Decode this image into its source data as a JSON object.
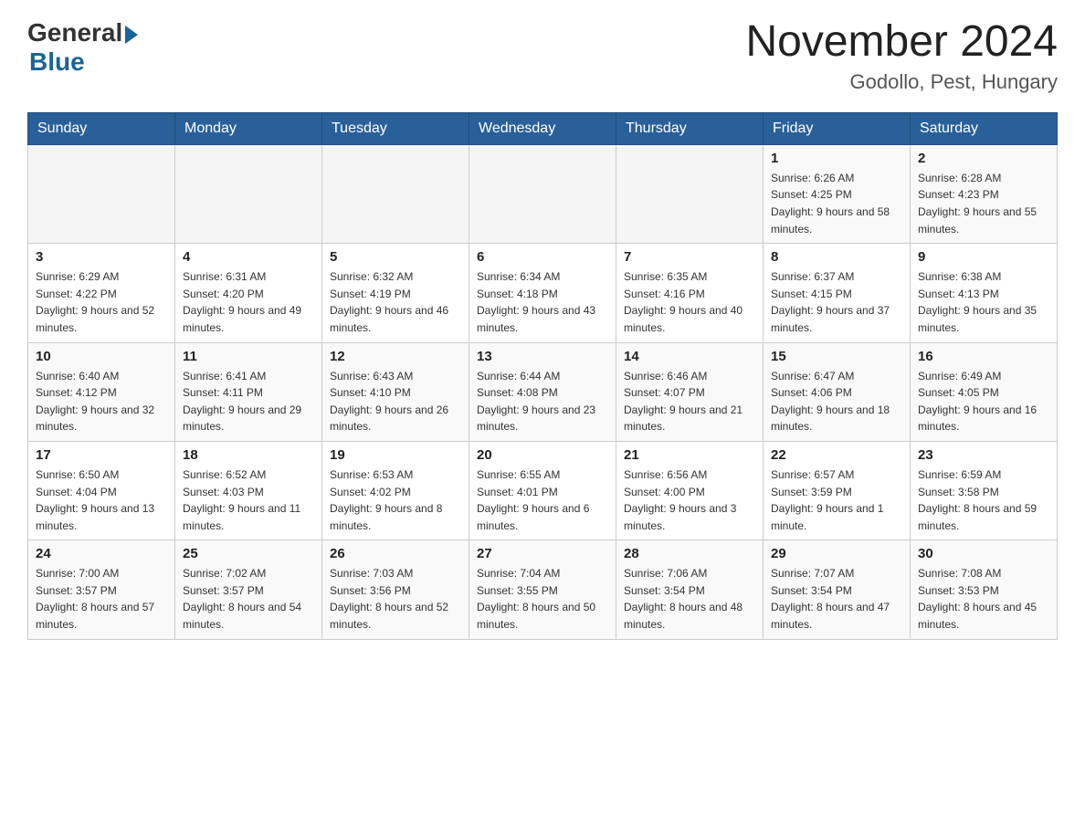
{
  "header": {
    "logo_general": "General",
    "logo_blue": "Blue",
    "month_title": "November 2024",
    "location": "Godollo, Pest, Hungary"
  },
  "days_of_week": [
    "Sunday",
    "Monday",
    "Tuesday",
    "Wednesday",
    "Thursday",
    "Friday",
    "Saturday"
  ],
  "weeks": [
    [
      {
        "day": "",
        "info": ""
      },
      {
        "day": "",
        "info": ""
      },
      {
        "day": "",
        "info": ""
      },
      {
        "day": "",
        "info": ""
      },
      {
        "day": "",
        "info": ""
      },
      {
        "day": "1",
        "info": "Sunrise: 6:26 AM\nSunset: 4:25 PM\nDaylight: 9 hours and 58 minutes."
      },
      {
        "day": "2",
        "info": "Sunrise: 6:28 AM\nSunset: 4:23 PM\nDaylight: 9 hours and 55 minutes."
      }
    ],
    [
      {
        "day": "3",
        "info": "Sunrise: 6:29 AM\nSunset: 4:22 PM\nDaylight: 9 hours and 52 minutes."
      },
      {
        "day": "4",
        "info": "Sunrise: 6:31 AM\nSunset: 4:20 PM\nDaylight: 9 hours and 49 minutes."
      },
      {
        "day": "5",
        "info": "Sunrise: 6:32 AM\nSunset: 4:19 PM\nDaylight: 9 hours and 46 minutes."
      },
      {
        "day": "6",
        "info": "Sunrise: 6:34 AM\nSunset: 4:18 PM\nDaylight: 9 hours and 43 minutes."
      },
      {
        "day": "7",
        "info": "Sunrise: 6:35 AM\nSunset: 4:16 PM\nDaylight: 9 hours and 40 minutes."
      },
      {
        "day": "8",
        "info": "Sunrise: 6:37 AM\nSunset: 4:15 PM\nDaylight: 9 hours and 37 minutes."
      },
      {
        "day": "9",
        "info": "Sunrise: 6:38 AM\nSunset: 4:13 PM\nDaylight: 9 hours and 35 minutes."
      }
    ],
    [
      {
        "day": "10",
        "info": "Sunrise: 6:40 AM\nSunset: 4:12 PM\nDaylight: 9 hours and 32 minutes."
      },
      {
        "day": "11",
        "info": "Sunrise: 6:41 AM\nSunset: 4:11 PM\nDaylight: 9 hours and 29 minutes."
      },
      {
        "day": "12",
        "info": "Sunrise: 6:43 AM\nSunset: 4:10 PM\nDaylight: 9 hours and 26 minutes."
      },
      {
        "day": "13",
        "info": "Sunrise: 6:44 AM\nSunset: 4:08 PM\nDaylight: 9 hours and 23 minutes."
      },
      {
        "day": "14",
        "info": "Sunrise: 6:46 AM\nSunset: 4:07 PM\nDaylight: 9 hours and 21 minutes."
      },
      {
        "day": "15",
        "info": "Sunrise: 6:47 AM\nSunset: 4:06 PM\nDaylight: 9 hours and 18 minutes."
      },
      {
        "day": "16",
        "info": "Sunrise: 6:49 AM\nSunset: 4:05 PM\nDaylight: 9 hours and 16 minutes."
      }
    ],
    [
      {
        "day": "17",
        "info": "Sunrise: 6:50 AM\nSunset: 4:04 PM\nDaylight: 9 hours and 13 minutes."
      },
      {
        "day": "18",
        "info": "Sunrise: 6:52 AM\nSunset: 4:03 PM\nDaylight: 9 hours and 11 minutes."
      },
      {
        "day": "19",
        "info": "Sunrise: 6:53 AM\nSunset: 4:02 PM\nDaylight: 9 hours and 8 minutes."
      },
      {
        "day": "20",
        "info": "Sunrise: 6:55 AM\nSunset: 4:01 PM\nDaylight: 9 hours and 6 minutes."
      },
      {
        "day": "21",
        "info": "Sunrise: 6:56 AM\nSunset: 4:00 PM\nDaylight: 9 hours and 3 minutes."
      },
      {
        "day": "22",
        "info": "Sunrise: 6:57 AM\nSunset: 3:59 PM\nDaylight: 9 hours and 1 minute."
      },
      {
        "day": "23",
        "info": "Sunrise: 6:59 AM\nSunset: 3:58 PM\nDaylight: 8 hours and 59 minutes."
      }
    ],
    [
      {
        "day": "24",
        "info": "Sunrise: 7:00 AM\nSunset: 3:57 PM\nDaylight: 8 hours and 57 minutes."
      },
      {
        "day": "25",
        "info": "Sunrise: 7:02 AM\nSunset: 3:57 PM\nDaylight: 8 hours and 54 minutes."
      },
      {
        "day": "26",
        "info": "Sunrise: 7:03 AM\nSunset: 3:56 PM\nDaylight: 8 hours and 52 minutes."
      },
      {
        "day": "27",
        "info": "Sunrise: 7:04 AM\nSunset: 3:55 PM\nDaylight: 8 hours and 50 minutes."
      },
      {
        "day": "28",
        "info": "Sunrise: 7:06 AM\nSunset: 3:54 PM\nDaylight: 8 hours and 48 minutes."
      },
      {
        "day": "29",
        "info": "Sunrise: 7:07 AM\nSunset: 3:54 PM\nDaylight: 8 hours and 47 minutes."
      },
      {
        "day": "30",
        "info": "Sunrise: 7:08 AM\nSunset: 3:53 PM\nDaylight: 8 hours and 45 minutes."
      }
    ]
  ]
}
